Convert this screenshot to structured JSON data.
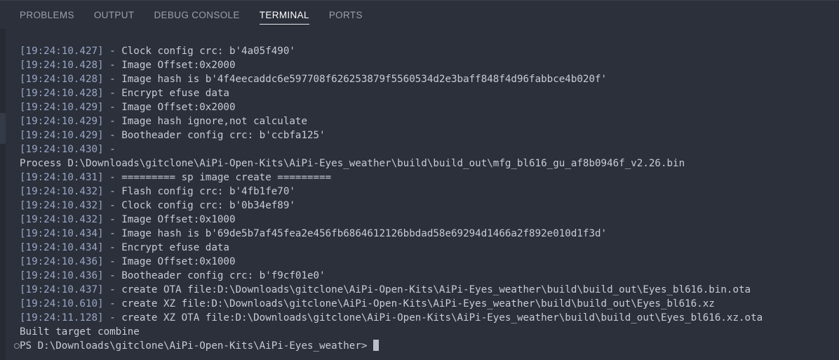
{
  "panel": {
    "tabs": [
      {
        "id": "problems",
        "label": "PROBLEMS",
        "active": false
      },
      {
        "id": "output",
        "label": "OUTPUT",
        "active": false
      },
      {
        "id": "debug-console",
        "label": "DEBUG CONSOLE",
        "active": false
      },
      {
        "id": "terminal",
        "label": "TERMINAL",
        "active": true
      },
      {
        "id": "ports",
        "label": "PORTS",
        "active": false
      }
    ]
  },
  "colors": {
    "background": "#2b303b",
    "tab_active_text": "#ffffff",
    "tab_inactive_text": "#9aa0ac",
    "timestamp": "#9aa6c4",
    "body_text": "#c8ccd6",
    "gutter": "#262a33",
    "cursor": "#b9bec9"
  },
  "terminal": {
    "lines": [
      {
        "ts": "[19:24:10.427]",
        "sep": " - ",
        "text": "Clock config crc: b'4a05f490'"
      },
      {
        "ts": "[19:24:10.428]",
        "sep": " - ",
        "text": "Image Offset:0x2000"
      },
      {
        "ts": "[19:24:10.428]",
        "sep": " - ",
        "text": "Image hash is b'4f4eecaddc6e597708f626253879f5560534d2e3baff848f4d96fabbce4b020f'"
      },
      {
        "ts": "[19:24:10.428]",
        "sep": " - ",
        "text": "Encrypt efuse data"
      },
      {
        "ts": "[19:24:10.429]",
        "sep": " - ",
        "text": "Image Offset:0x2000"
      },
      {
        "ts": "[19:24:10.429]",
        "sep": " - ",
        "text": "Image hash ignore,not calculate"
      },
      {
        "ts": "[19:24:10.429]",
        "sep": " - ",
        "text": "Bootheader config crc: b'ccbfa125'"
      },
      {
        "ts": "[19:24:10.430]",
        "sep": " - ",
        "text": ""
      },
      {
        "ts": "",
        "sep": "",
        "text": "Process D:\\Downloads\\gitclone\\AiPi-Open-Kits\\AiPi-Eyes_weather\\build\\build_out\\mfg_bl616_gu_af8b0946f_v2.26.bin"
      },
      {
        "ts": "[19:24:10.431]",
        "sep": " - ",
        "text": "========= sp image create ========="
      },
      {
        "ts": "[19:24:10.432]",
        "sep": " - ",
        "text": "Flash config crc: b'4fb1fe70'"
      },
      {
        "ts": "[19:24:10.432]",
        "sep": " - ",
        "text": "Clock config crc: b'0b34ef89'"
      },
      {
        "ts": "[19:24:10.432]",
        "sep": " - ",
        "text": "Image Offset:0x1000"
      },
      {
        "ts": "[19:24:10.434]",
        "sep": " - ",
        "text": "Image hash is b'69de5b7af45fea2e456fb6864612126bbdad58e69294d1466a2f892e010d1f3d'"
      },
      {
        "ts": "[19:24:10.434]",
        "sep": " - ",
        "text": "Encrypt efuse data"
      },
      {
        "ts": "[19:24:10.436]",
        "sep": " - ",
        "text": "Image Offset:0x1000"
      },
      {
        "ts": "[19:24:10.436]",
        "sep": " - ",
        "text": "Bootheader config crc: b'f9cf01e0'"
      },
      {
        "ts": "[19:24:10.437]",
        "sep": " - ",
        "text": "create OTA file:D:\\Downloads\\gitclone\\AiPi-Open-Kits\\AiPi-Eyes_weather\\build\\build_out\\Eyes_bl616.bin.ota"
      },
      {
        "ts": "[19:24:10.610]",
        "sep": " - ",
        "text": "create XZ file:D:\\Downloads\\gitclone\\AiPi-Open-Kits\\AiPi-Eyes_weather\\build\\build_out\\Eyes_bl616.xz"
      },
      {
        "ts": "[19:24:11.128]",
        "sep": " - ",
        "text": "create XZ OTA file:D:\\Downloads\\gitclone\\AiPi-Open-Kits\\AiPi-Eyes_weather\\build\\build_out\\Eyes_bl616.xz.ota"
      },
      {
        "ts": "",
        "sep": "",
        "text": "Built target combine"
      }
    ],
    "prompt": {
      "text": "PS D:\\Downloads\\gitclone\\AiPi-Open-Kits\\AiPi-Eyes_weather> ",
      "decoration": "command-decoration-circle"
    }
  }
}
